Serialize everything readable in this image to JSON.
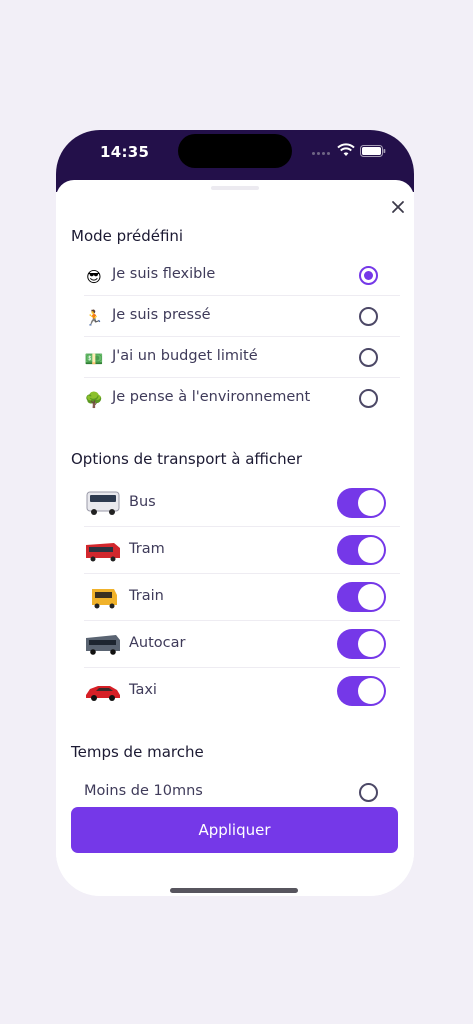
{
  "status": {
    "time": "14:35"
  },
  "modes": {
    "title": "Mode prédéfini",
    "selected_index": 0,
    "items": [
      {
        "emoji": "😎",
        "label": "Je suis flexible",
        "selected": true
      },
      {
        "emoji": "🏃",
        "label": "Je suis pressé",
        "selected": false
      },
      {
        "emoji": "💵",
        "label": "J'ai un budget limité",
        "selected": false
      },
      {
        "emoji": "🌳",
        "label": "Je pense à l'environnement",
        "selected": false
      }
    ]
  },
  "transport": {
    "title": "Options de transport à afficher",
    "items": [
      {
        "icon": "bus-icon",
        "label": "Bus",
        "enabled": true
      },
      {
        "icon": "tram-icon",
        "label": "Tram",
        "enabled": true
      },
      {
        "icon": "train-icon",
        "label": "Train",
        "enabled": true
      },
      {
        "icon": "coach-icon",
        "label": "Autocar",
        "enabled": true
      },
      {
        "icon": "taxi-icon",
        "label": "Taxi",
        "enabled": true
      }
    ]
  },
  "walking": {
    "title": "Temps de marche",
    "items": [
      {
        "label": "Moins de 10mns",
        "selected": false
      }
    ]
  },
  "apply_label": "Appliquer",
  "colors": {
    "accent": "#7538e8",
    "status_bar": "#23104a",
    "page_bg": "#f2eff7"
  }
}
